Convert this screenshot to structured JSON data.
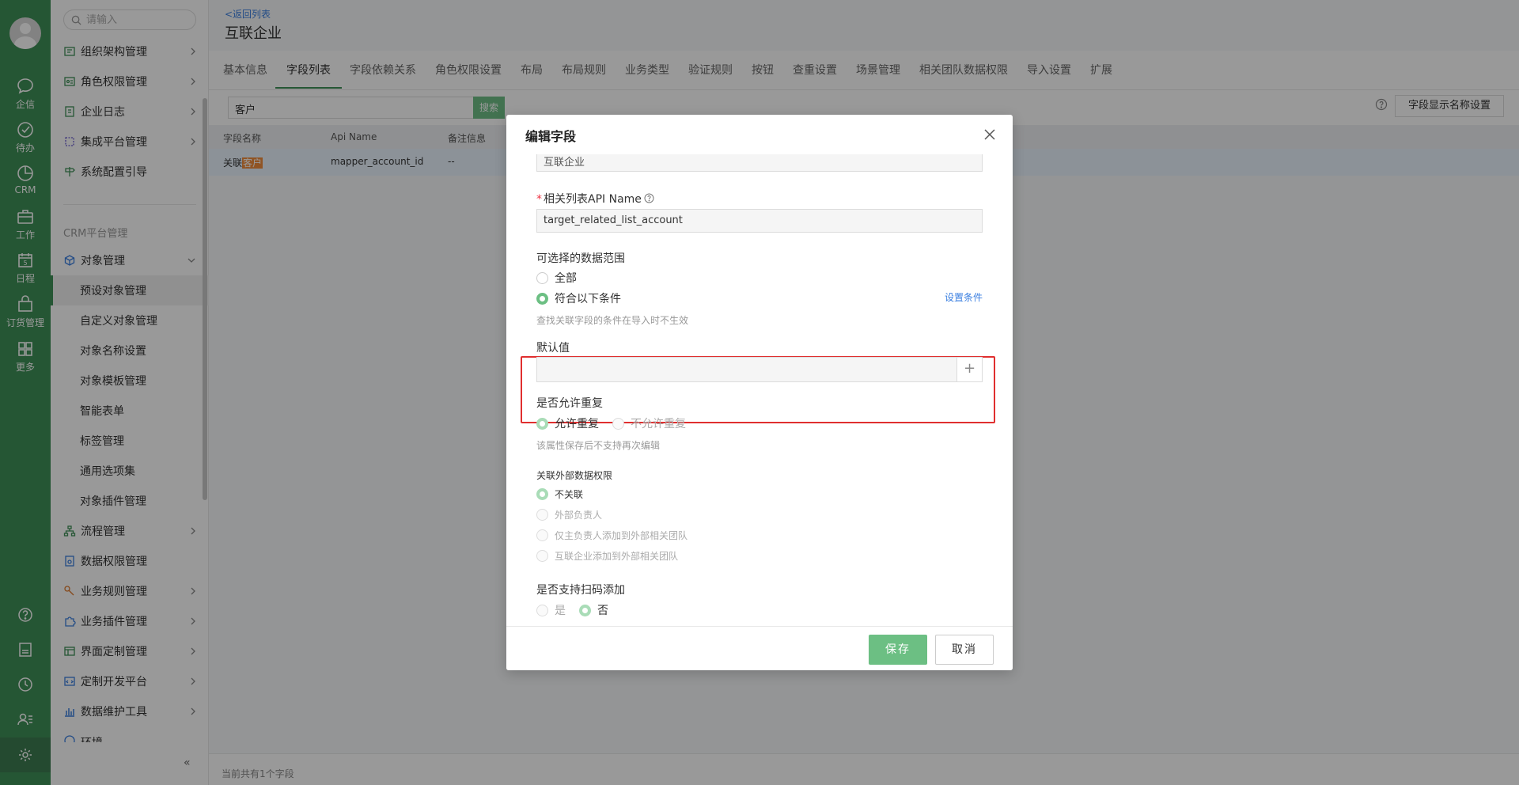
{
  "rail": {
    "items": [
      {
        "label": "企信",
        "icon": "chat-icon"
      },
      {
        "label": "待办",
        "icon": "check-circle-icon"
      },
      {
        "label": "CRM",
        "icon": "pie-chart-icon"
      },
      {
        "label": "工作",
        "icon": "briefcase-icon"
      },
      {
        "label": "日程",
        "icon": "calendar-icon",
        "day": "5"
      },
      {
        "label": "订货管理",
        "icon": "shopping-bag-icon"
      },
      {
        "label": "更多",
        "icon": "grid-icon"
      }
    ],
    "bottom_icons": [
      "help-icon",
      "document-icon",
      "clock-icon",
      "user-list-icon",
      "gear-icon"
    ]
  },
  "sidebar": {
    "search_placeholder": "请输入",
    "top_items": [
      {
        "label": "组织架构管理",
        "icon": "org-icon"
      },
      {
        "label": "角色权限管理",
        "icon": "id-card-icon"
      },
      {
        "label": "企业日志",
        "icon": "log-icon"
      },
      {
        "label": "集成平台管理",
        "icon": "integration-icon"
      },
      {
        "label": "系统配置引导",
        "icon": "signpost-icon"
      }
    ],
    "section_title": "CRM平台管理",
    "object_mgmt": "对象管理",
    "sub_items": [
      "预设对象管理",
      "自定义对象管理",
      "对象名称设置",
      "对象模板管理",
      "智能表单",
      "标签管理",
      "通用选项集",
      "对象插件管理"
    ],
    "bottom_items": [
      {
        "label": "流程管理",
        "icon": "flow-icon"
      },
      {
        "label": "数据权限管理",
        "icon": "data-permission-icon"
      },
      {
        "label": "业务规则管理",
        "icon": "wrench-icon"
      },
      {
        "label": "业务插件管理",
        "icon": "puzzle-icon"
      },
      {
        "label": "界面定制管理",
        "icon": "layout-icon"
      },
      {
        "label": "定制开发平台",
        "icon": "code-icon"
      },
      {
        "label": "数据维护工具",
        "icon": "bar-chart-icon"
      },
      {
        "label": "环境",
        "icon": "env-icon"
      }
    ]
  },
  "main": {
    "back_link": "<返回列表",
    "title": "互联企业",
    "tabs": [
      "基本信息",
      "字段列表",
      "字段依赖关系",
      "角色权限设置",
      "布局",
      "布局规则",
      "业务类型",
      "验证规则",
      "按钮",
      "查重设置",
      "场景管理",
      "相关团队数据权限",
      "导入设置",
      "扩展"
    ],
    "active_tab": "字段列表",
    "search_value": "客户",
    "search_button": "搜索",
    "display_button": "字段显示名称设置",
    "columns": [
      "字段名称",
      "Api Name",
      "备注信息"
    ],
    "row": {
      "name_prefix": "关联",
      "name_highlight": "客户",
      "api": "mapper_account_id",
      "note": "--"
    },
    "footer": "当前共有1个字段"
  },
  "dialog": {
    "title": "编辑字段",
    "top_value": "互联企业",
    "api_label": "相关列表API Name",
    "api_value": "target_related_list_account",
    "range_label": "可选择的数据范围",
    "range_all": "全部",
    "range_cond": "符合以下条件",
    "set_condition": "设置条件",
    "range_hint": "查找关联字段的条件在导入时不生效",
    "default_label": "默认值",
    "dup_label": "是否允许重复",
    "dup_yes": "允许重复",
    "dup_no": "不允许重复",
    "dup_hint": "该属性保存后不支持再次编辑",
    "ext_label": "关联外部数据权限",
    "ext_opts": [
      "不关联",
      "外部负责人",
      "仅主负责人添加到外部相关团队",
      "互联企业添加到外部相关团队"
    ],
    "scan_label": "是否支持扫码添加",
    "scan_yes": "是",
    "scan_no": "否",
    "save": "保存",
    "cancel": "取消"
  },
  "colors": {
    "brand_green": "#3f8f58",
    "accent_green": "#6cbf83",
    "link_blue": "#3b7fe0",
    "highlight_border": "#e02f2f"
  }
}
